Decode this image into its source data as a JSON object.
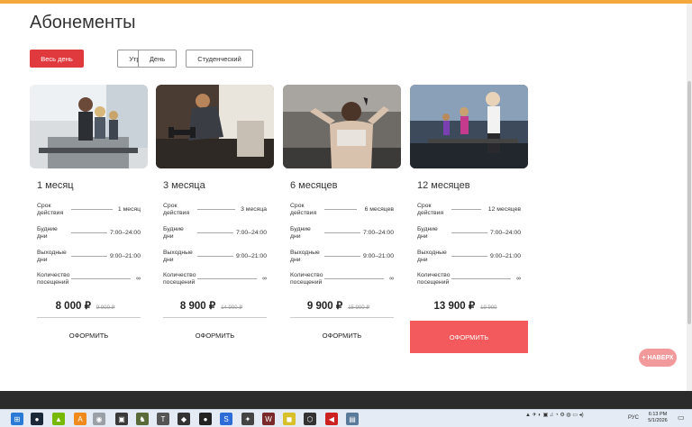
{
  "page": {
    "title": "Абонементы"
  },
  "filters": [
    {
      "label": "Весь день",
      "active": true
    },
    {
      "label": "Утро",
      "active": false
    },
    {
      "label": "День",
      "active": false
    },
    {
      "label": "Студенческий",
      "active": false
    }
  ],
  "labels": {
    "term": "Срок действия",
    "weekdays": "Будние дни",
    "weekends": "Выходные дни",
    "visits": "Количество посещений"
  },
  "cards": [
    {
      "title": "1 месяц",
      "term": "1 месяц",
      "weekdays": "7:00–24:00",
      "weekends": "9:00–21:00",
      "visits": "∞",
      "price": "8 000 ₽",
      "old_price": "9 900 ₽",
      "button": "ОФОРМИТЬ",
      "image": "gym-treadmill-group-photo"
    },
    {
      "title": "3 месяца",
      "term": "3 месяца",
      "weekdays": "7:00–24:00",
      "weekends": "9:00–21:00",
      "visits": "∞",
      "price": "8 900 ₽",
      "old_price": "14 900 ₽",
      "button": "ОФОРМИТЬ",
      "image": "gym-dumbbell-woman-photo"
    },
    {
      "title": "6 месяцев",
      "term": "6 месяцев",
      "weekdays": "7:00–24:00",
      "weekends": "9:00–21:00",
      "visits": "∞",
      "price": "9 900 ₽",
      "old_price": "15 900 ₽",
      "button": "ОФОРМИТЬ",
      "image": "gym-situps-woman-photo"
    },
    {
      "title": "12 месяцев",
      "term": "12 месяцев",
      "weekdays": "7:00–24:00",
      "weekends": "9:00–21:00",
      "visits": "∞",
      "price": "13 900 ₽",
      "old_price": "19 900",
      "button": "ОФОРМИТЬ",
      "image": "gym-treadmill-women-photo"
    }
  ],
  "back_to_top": "+ НАВЕРХ",
  "colors": {
    "accent": "#e03a3f",
    "accent_hover": "#f25a5d",
    "top_bar": "#f2a83a"
  },
  "taskbar": {
    "lang": "РУС",
    "time": "6:13 PM",
    "date": "5/1/2026"
  }
}
